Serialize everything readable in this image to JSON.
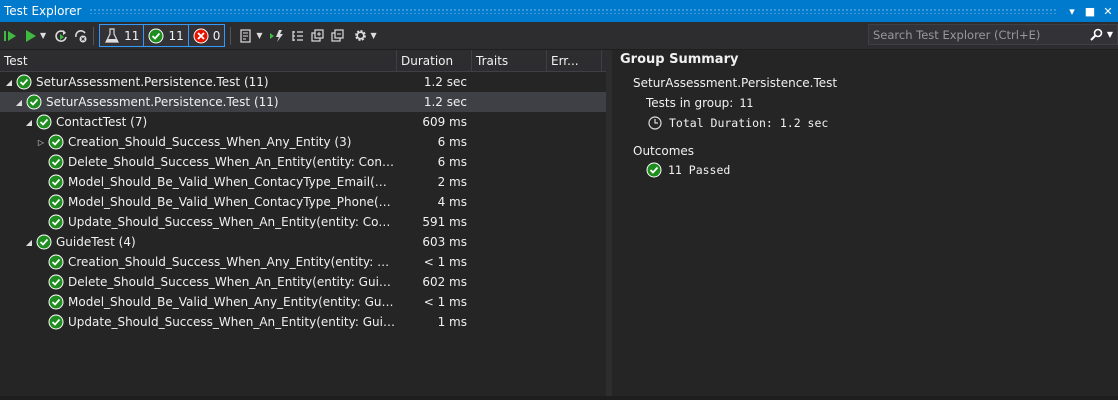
{
  "window": {
    "title": "Test Explorer"
  },
  "toolbar": {
    "counters": {
      "total": "11",
      "passed": "11",
      "failed": "0"
    }
  },
  "search": {
    "placeholder": "Search Test Explorer (Ctrl+E)"
  },
  "columns": {
    "test": "Test",
    "duration": "Duration",
    "traits": "Traits",
    "error": "Err..."
  },
  "tree": [
    {
      "name": "SeturAssessment.Persistence.Test  (11)",
      "duration": "1.2 sec",
      "level": 0,
      "exp": "open",
      "selected": false
    },
    {
      "name": "SeturAssessment.Persistence.Test  (11)",
      "duration": "1.2 sec",
      "level": 1,
      "exp": "open",
      "selected": true
    },
    {
      "name": "ContactTest  (7)",
      "duration": "609 ms",
      "level": 2,
      "exp": "open",
      "selected": false
    },
    {
      "name": "Creation_Should_Success_When_Any_Entity  (3)",
      "duration": "6 ms",
      "level": 3,
      "exp": "closed",
      "selected": false
    },
    {
      "name": "Delete_Should_Success_When_An_Entity(entity: Contact { C...",
      "duration": "6 ms",
      "level": 3,
      "exp": "none",
      "selected": false
    },
    {
      "name": "Model_Should_Be_Valid_When_ContacyType_Email(mail: \"m...",
      "duration": "2 ms",
      "level": 3,
      "exp": "none",
      "selected": false
    },
    {
      "name": "Model_Should_Be_Valid_When_ContacyType_Phone(phone:...",
      "duration": "4 ms",
      "level": 3,
      "exp": "none",
      "selected": false
    },
    {
      "name": "Update_Should_Success_When_An_Entity(entity: Contact { C...",
      "duration": "591 ms",
      "level": 3,
      "exp": "none",
      "selected": false
    },
    {
      "name": "GuideTest  (4)",
      "duration": "603 ms",
      "level": 2,
      "exp": "open",
      "selected": false
    },
    {
      "name": "Creation_Should_Success_When_Any_Entity(entity: Guide {...",
      "duration": "< 1 ms",
      "level": 3,
      "exp": "none",
      "selected": false
    },
    {
      "name": "Delete_Should_Success_When_An_Entity(entity: Guide { Co...",
      "duration": "602 ms",
      "level": 3,
      "exp": "none",
      "selected": false
    },
    {
      "name": "Model_Should_Be_Valid_When_Any_Entity(entity: Guide { C...",
      "duration": "< 1 ms",
      "level": 3,
      "exp": "none",
      "selected": false
    },
    {
      "name": "Update_Should_Success_When_An_Entity(entity: Guide { Co...",
      "duration": "1 ms",
      "level": 3,
      "exp": "none",
      "selected": false
    }
  ],
  "summary": {
    "title": "Group Summary",
    "group_name": "SeturAssessment.Persistence.Test",
    "tests_label": "Tests in group:",
    "tests_value": "11",
    "duration_label": "Total Duration:",
    "duration_value": "1.2 sec",
    "outcomes_label": "Outcomes",
    "passed_text": "11 Passed"
  },
  "colors": {
    "accent": "#007acc",
    "pass": "#1e8c1e",
    "fail": "#e51400",
    "background": "#252526"
  }
}
